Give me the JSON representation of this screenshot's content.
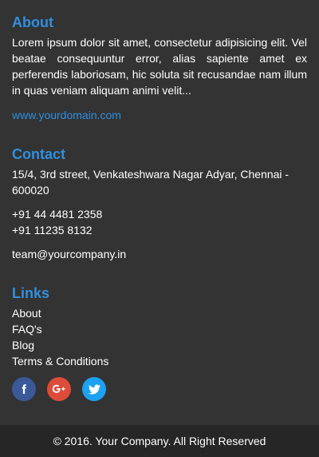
{
  "about": {
    "heading": "About",
    "text": "Lorem ipsum dolor sit amet, consectetur adipisicing elit. Vel beatae consequuntur error, alias sapiente amet ex perferendis laboriosam, hic soluta sit recusandae nam illum in quas veniam aliquam animi velit...",
    "link": "www.yourdomain.com"
  },
  "contact": {
    "heading": "Contact",
    "address": "15/4, 3rd street, Venkateshwara Nagar Adyar, Chennai - 600020",
    "phone1": "+91 44 4481 2358",
    "phone2": "+91 11235 8132",
    "email": "team@yourcompany.in"
  },
  "links": {
    "heading": "Links",
    "items": [
      "About",
      "FAQ's",
      "Blog",
      "Terms & Conditions"
    ]
  },
  "social": [
    {
      "name": "facebook",
      "icon": "facebook-icon",
      "color": "#3b5998"
    },
    {
      "name": "google-plus",
      "icon": "google-plus-icon",
      "color": "#dd4b39"
    },
    {
      "name": "twitter",
      "icon": "twitter-icon",
      "color": "#1da1f2"
    }
  ],
  "colors": {
    "accent": "#2f8fe0",
    "background": "#333333",
    "bottom_bar": "#262626"
  },
  "footer": {
    "copyright": "© 2016. Your Company. All Right Reserved"
  }
}
